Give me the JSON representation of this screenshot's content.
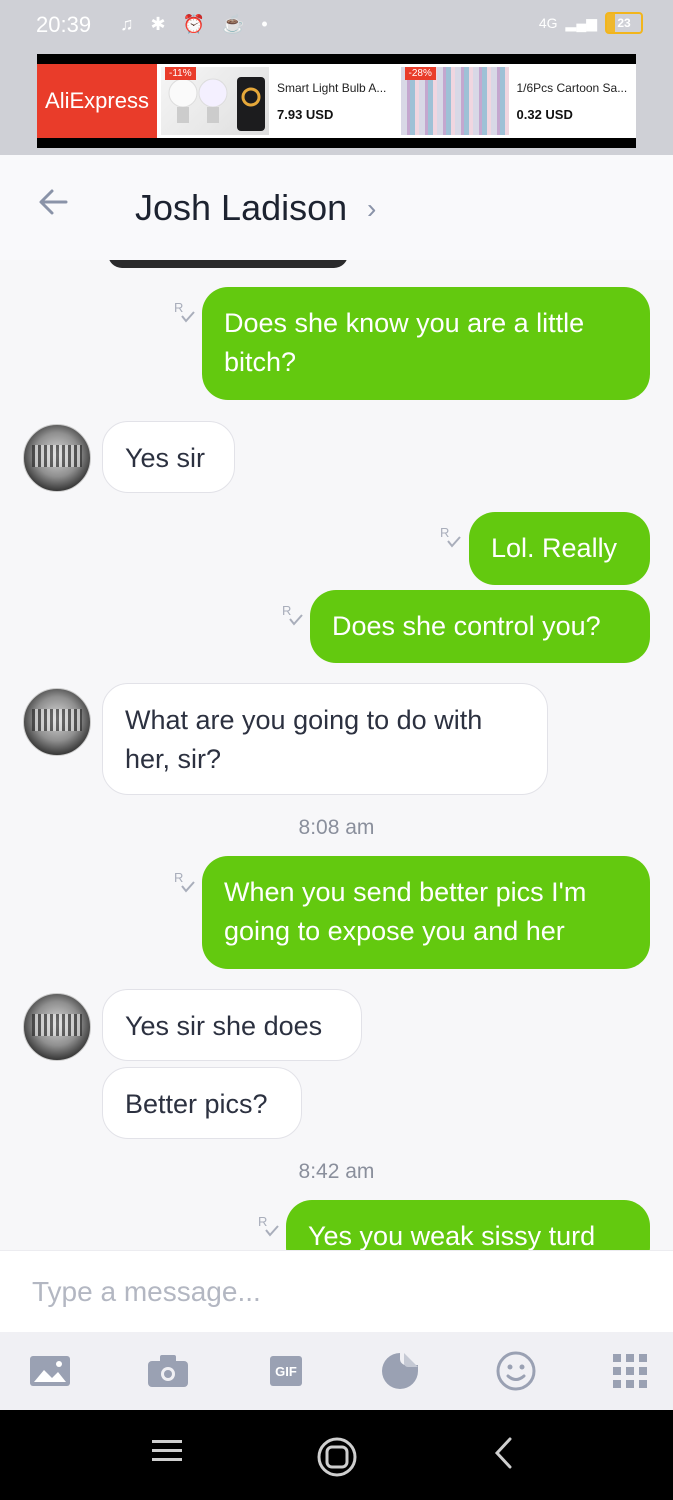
{
  "status": {
    "time": "20:39",
    "battery": "23",
    "network": "4G"
  },
  "ad": {
    "brand": "AliExpress",
    "products": [
      {
        "title": "Smart Light Bulb A...",
        "price": "7.93 USD",
        "discount": "-11%"
      },
      {
        "title": "1/6Pcs Cartoon Sa...",
        "price": "0.32 USD",
        "discount": "-28%"
      }
    ]
  },
  "header": {
    "contact_name": "Josh Ladison"
  },
  "messages": [
    {
      "dir": "out",
      "text_line1": "Does she know you are a little",
      "text_line2": "bitch?"
    },
    {
      "dir": "in",
      "text": "Yes sir"
    },
    {
      "dir": "out",
      "text": "Lol. Really"
    },
    {
      "dir": "out",
      "text": "Does she control you?"
    },
    {
      "dir": "in",
      "text_line1": "What are you going to do with",
      "text_line2": "her, sir?"
    },
    {
      "dir": "out",
      "text_line1": "When you send better pics I'm",
      "text_line2": "going to expose you and her"
    },
    {
      "dir": "in",
      "text": "Yes sir she does"
    },
    {
      "dir": "in",
      "text": "Better pics?"
    },
    {
      "dir": "out",
      "text": "Yes you weak sissy turd"
    }
  ],
  "timestamps": {
    "t1": "8:08 am",
    "t2": "8:42 am"
  },
  "composer": {
    "placeholder": "Type a message..."
  },
  "toolbar": {
    "gif_label": "GIF"
  },
  "colors": {
    "outgoing": "#63c90f",
    "incoming": "#ffffff",
    "brand": "#e93c2a"
  }
}
